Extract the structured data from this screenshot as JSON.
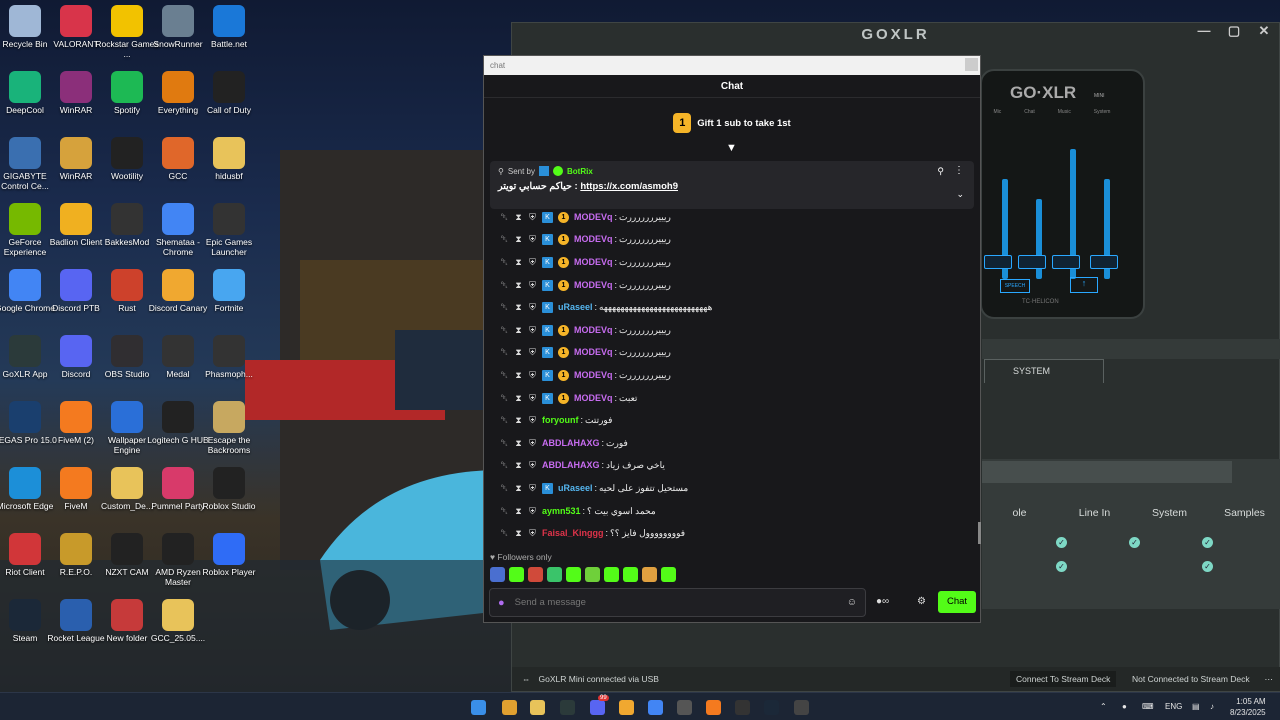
{
  "desktop": {
    "icons": [
      [
        "Recycle Bin",
        "#9fb7d6"
      ],
      [
        "VALORANT",
        "#d8344a"
      ],
      [
        "Rockstar Games ...",
        "#f2c200"
      ],
      [
        "SnowRunner",
        "#6a7f91"
      ],
      [
        "Battle.net",
        "#1a78d8"
      ],
      [
        "DeepCool",
        "#19b37a"
      ],
      [
        "WinRAR",
        "#8b2f7a"
      ],
      [
        "Spotify",
        "#1db954"
      ],
      [
        "Everything",
        "#e07a10"
      ],
      [
        "Call of Duty",
        "#222222"
      ],
      [
        "GIGABYTE Control Ce...",
        "#3a6fb0"
      ],
      [
        "WinRAR",
        "#d6a23c"
      ],
      [
        "Wootility",
        "#222222"
      ],
      [
        "GCC",
        "#e0672a"
      ],
      [
        "hidusbf",
        "#e8c35a"
      ],
      [
        "GeForce Experience",
        "#76b900"
      ],
      [
        "Badlion Client",
        "#f0b020"
      ],
      [
        "BakkesMod",
        "#333333"
      ],
      [
        "Shemataa - Chrome",
        "#4285f4"
      ],
      [
        "Epic Games Launcher",
        "#333333"
      ],
      [
        "Google Chrome",
        "#4285f4"
      ],
      [
        "Discord PTB",
        "#5865f2"
      ],
      [
        "Rust",
        "#cd412b"
      ],
      [
        "Discord Canary",
        "#f0a830"
      ],
      [
        "Fortnite",
        "#48a6f0"
      ],
      [
        "GoXLR App",
        "#2b3a3a"
      ],
      [
        "Discord",
        "#5865f2"
      ],
      [
        "OBS Studio",
        "#302e31"
      ],
      [
        "Medal",
        "#333333"
      ],
      [
        "Phasmoph...",
        "#333333"
      ],
      [
        "VEGAS Pro 15.0",
        "#1a3f6e"
      ],
      [
        "FiveM (2)",
        "#f47a1f"
      ],
      [
        "Wallpaper Engine",
        "#2a6fd8"
      ],
      [
        "Logitech G HUB",
        "#222222"
      ],
      [
        "Escape the Backrooms",
        "#c7a860"
      ],
      [
        "Microsoft Edge",
        "#1c8fd8"
      ],
      [
        "FiveM",
        "#f47a1f"
      ],
      [
        "Custom_De...",
        "#e8c35a"
      ],
      [
        "Pummel Party",
        "#d83a6a"
      ],
      [
        "Roblox Studio",
        "#222222"
      ],
      [
        "Riot Client",
        "#d13639"
      ],
      [
        "R.E.P.O.",
        "#c89a2a"
      ],
      [
        "NZXT CAM",
        "#222222"
      ],
      [
        "AMD Ryzen Master",
        "#222222"
      ],
      [
        "Roblox Player",
        "#2f6cf6"
      ],
      [
        "Steam",
        "#1b2838"
      ],
      [
        "Rocket League",
        "#2a5fae"
      ],
      [
        "New folder",
        "#c63a3a"
      ],
      [
        "GCC_25.05....",
        "#e8c35a"
      ]
    ]
  },
  "goxlr": {
    "title": "GOXLR",
    "device_brand": "GO·XLR",
    "device_brand_sub": "MINI",
    "device_footer": "TC·HELICON",
    "device_labels": [
      "Mic",
      "Chat",
      "Music",
      "System"
    ],
    "sample_btn": "SPEECH",
    "tab_system": "SYSTEM",
    "mix_columns": [
      "ole",
      "Line In",
      "System",
      "Samples"
    ],
    "status_left": "GoXLR Mini connected via USB",
    "status_mid": "Connect To Stream Deck",
    "status_right": "Not Connected to Stream Deck"
  },
  "chat": {
    "window_title": "chat",
    "header": "Chat",
    "gift": "Gift 1 sub to take 1st",
    "gift_badge": "1",
    "pinned": {
      "sent_by": "Sent by",
      "bot": "BotRix",
      "text": "حياكم حسابي تويتر :",
      "link": "https://x.com/asmoh9"
    },
    "messages": [
      {
        "user": "MODEVq",
        "text": "ريييرررررررت",
        "color": "#c76cf0",
        "badges": [
          "kick",
          "coin"
        ]
      },
      {
        "user": "MODEVq",
        "text": "ريييرررررررت",
        "color": "#c76cf0",
        "badges": [
          "kick",
          "coin"
        ]
      },
      {
        "user": "MODEVq",
        "text": "ريييرررررررت",
        "color": "#c76cf0",
        "badges": [
          "kick",
          "coin"
        ]
      },
      {
        "user": "MODEVq",
        "text": "ريييرررررررت",
        "color": "#c76cf0",
        "badges": [
          "kick",
          "coin"
        ]
      },
      {
        "user": "uRaseel",
        "text": "ههههههههههههههههههههههههههه",
        "color": "#55b6f0",
        "badges": [
          "kick"
        ]
      },
      {
        "user": "MODEVq",
        "text": "ريييرررررررت",
        "color": "#c76cf0",
        "badges": [
          "kick",
          "coin"
        ]
      },
      {
        "user": "MODEVq",
        "text": "ريييرررررررت",
        "color": "#c76cf0",
        "badges": [
          "kick",
          "coin"
        ]
      },
      {
        "user": "MODEVq",
        "text": "ريييرررررررت",
        "color": "#c76cf0",
        "badges": [
          "kick",
          "coin"
        ]
      },
      {
        "user": "MODEVq",
        "text": "تعبت",
        "color": "#c76cf0",
        "badges": [
          "kick",
          "coin"
        ]
      },
      {
        "user": "foryounf",
        "text": "فورتتت",
        "color": "#53fc18",
        "badges": []
      },
      {
        "user": "ABDLAHAXG",
        "text": "فورت",
        "color": "#c76cf0",
        "badges": []
      },
      {
        "user": "ABDLAHAXG",
        "text": "ياخي صرف زياد",
        "color": "#c76cf0",
        "badges": []
      },
      {
        "user": "uRaseel",
        "text": "مستحيل تتفوز على لحيه",
        "color": "#55b6f0",
        "badges": [
          "kick"
        ]
      },
      {
        "user": "aymn531",
        "text": "محمد اسوي بيت ؟",
        "color": "#53fc18",
        "badges": []
      },
      {
        "user": "Faisal_Kinggg",
        "text": "فوووووووول فايز ؟؟",
        "color": "#e0334a",
        "badges": []
      }
    ],
    "followers_only": "Followers only",
    "input_placeholder": "Send a message",
    "send_label": "Chat"
  },
  "taskbar": {
    "lang": "ENG",
    "time": "1:05 AM",
    "date": "8/23/2025",
    "badge_discord": "99"
  }
}
